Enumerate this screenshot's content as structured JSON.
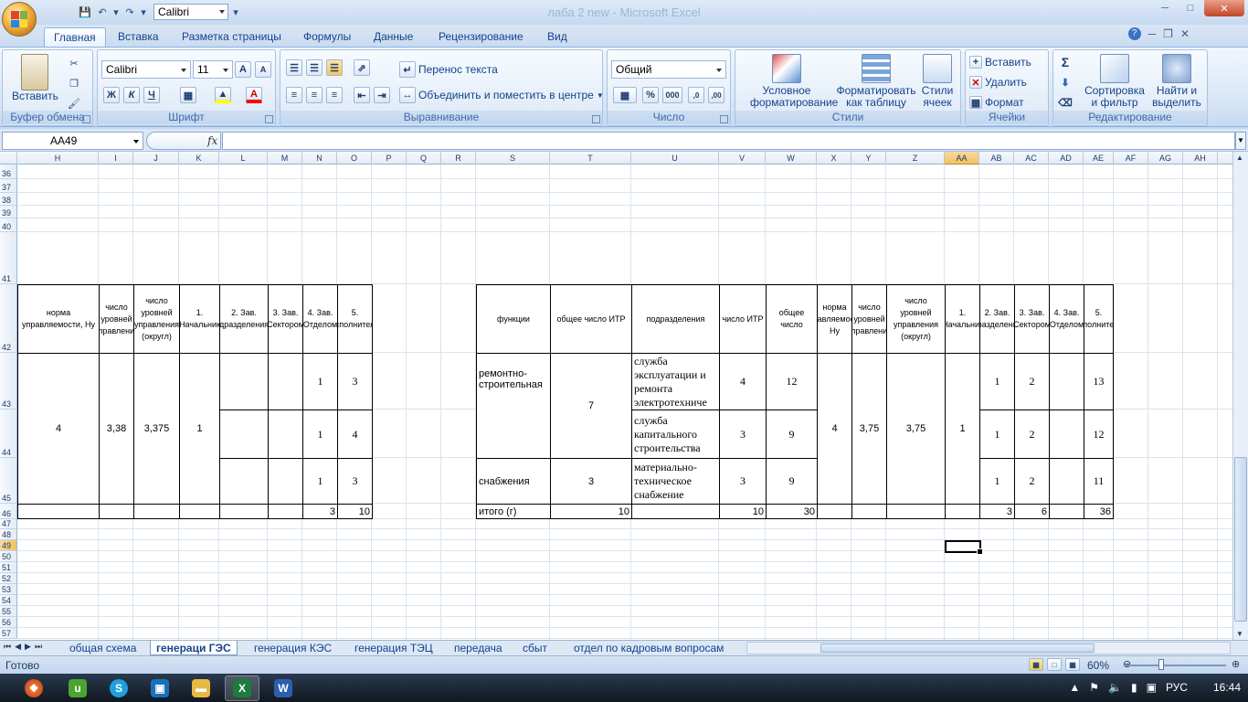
{
  "window": {
    "title": "лаба 2 new - Microsoft Excel",
    "quick_font": "Calibri"
  },
  "ribbon_tabs": [
    "Главная",
    "Вставка",
    "Разметка страницы",
    "Формулы",
    "Данные",
    "Рецензирование",
    "Вид"
  ],
  "ribbon": {
    "clipboard": {
      "paste": "Вставить",
      "label": "Буфер обмена"
    },
    "font": {
      "name": "Calibri",
      "size": "11",
      "bold": "Ж",
      "italic": "К",
      "underline": "Ч",
      "label": "Шрифт"
    },
    "alignment": {
      "wrap": "Перенос текста",
      "merge": "Объединить и поместить в центре",
      "label": "Выравнивание"
    },
    "number": {
      "format": "Общий",
      "percent": "%",
      "thousands": "000",
      "label": "Число"
    },
    "styles": {
      "conditional": "Условное форматирование",
      "format_table": "Форматировать как таблицу",
      "cell_styles": "Стили ячеек",
      "label": "Стили"
    },
    "cells": {
      "insert": "Вставить",
      "delete": "Удалить",
      "format": "Формат",
      "label": "Ячейки"
    },
    "editing": {
      "sort": "Сортировка и фильтр",
      "find": "Найти и выделить",
      "label": "Редактирование"
    }
  },
  "formula_bar": {
    "name_box": "AA49",
    "fx": "fx",
    "formula": ""
  },
  "columns": [
    "H",
    "I",
    "J",
    "K",
    "L",
    "M",
    "N",
    "O",
    "P",
    "Q",
    "R",
    "S",
    "T",
    "U",
    "V",
    "W",
    "X",
    "Y",
    "Z",
    "AA",
    "AB",
    "AC",
    "AD",
    "AE",
    "AF",
    "AG",
    "AH"
  ],
  "selected_column": "AA",
  "rows": [
    "36",
    "37",
    "38",
    "39",
    "40",
    "41",
    "42",
    "43",
    "44",
    "45",
    "46",
    "47",
    "48",
    "49",
    "50",
    "51",
    "52",
    "53",
    "54",
    "55",
    "56",
    "57"
  ],
  "selected_row": "49",
  "left_table": {
    "headers": [
      "норма управляемости, Ну",
      "число уровней управления",
      "число уровней управления (округл)",
      "1. Начальник",
      "2. Зав. Подразделениями",
      "3. Зав. Сектором",
      "4. Зав. Отделом",
      "5. исполнители"
    ],
    "norm": "4",
    "levels": "3,38",
    "levels_round": "3,375",
    "chief": "1",
    "rows": [
      {
        "n": "1",
        "o": "3"
      },
      {
        "n": "1",
        "o": "4"
      },
      {
        "n": "1",
        "o": "3"
      }
    ],
    "total_n": "3",
    "total_o": "10"
  },
  "right_table": {
    "headers": [
      "функции",
      "общее число ИТР",
      "подразделения",
      "число ИТР",
      "общее число",
      "норма управляемости, Ну",
      "число уровней управления",
      "число уровней управления (округл)",
      "1. Начальник",
      "2. Зав. Подразделениями",
      "3. Зав. Сектором",
      "4. Зав. Отделом",
      "5. исполнители"
    ],
    "func1": "ремонтно-строительная",
    "func1_total": "7",
    "func2": "снабжения",
    "func2_total": "3",
    "norm": "4",
    "levels": "3,75",
    "levels_round": "3,75",
    "chief": "1",
    "rows": [
      {
        "dept": "служба эксплуатации и ремонта электротехниче",
        "itr": "4",
        "total": "12",
        "ab": "1",
        "ac": "2",
        "ae": "13"
      },
      {
        "dept": "служба капитального строительства",
        "itr": "3",
        "total": "9",
        "ab": "1",
        "ac": "2",
        "ae": "12"
      },
      {
        "dept": "материально-техническое снабжение",
        "itr": "3",
        "total": "9",
        "ab": "1",
        "ac": "2",
        "ae": "11"
      }
    ],
    "total_label": "итого (г)",
    "total_t": "10",
    "total_v": "10",
    "total_w": "30",
    "total_ab": "3",
    "total_ac": "6",
    "total_ae": "36"
  },
  "sheet_tabs": [
    "общая схема",
    "генераци ГЭС",
    "генерация КЭС",
    "генерация ТЭЦ",
    "передача",
    "сбыт",
    "отдел по кадровым вопросам"
  ],
  "active_sheet": "генераци ГЭС",
  "status": {
    "text": "Готово",
    "zoom": "60%"
  },
  "taskbar": {
    "lang": "РУС",
    "time": "16:44"
  }
}
